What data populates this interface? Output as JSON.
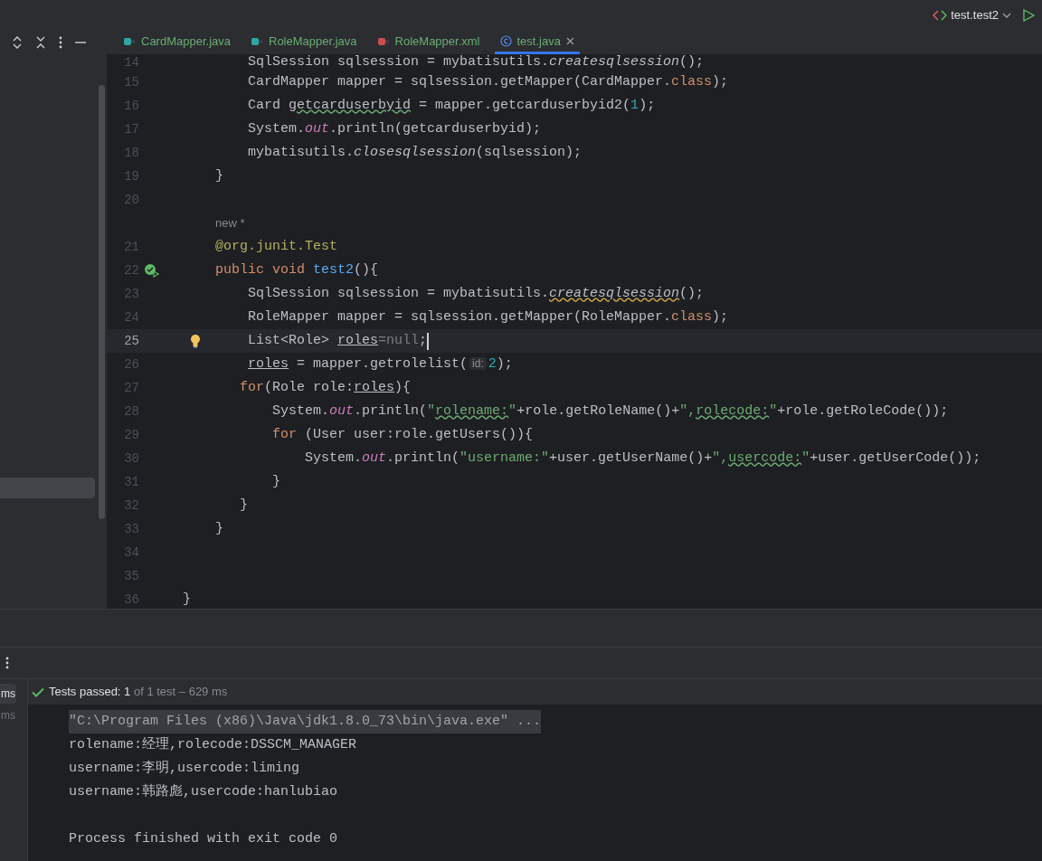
{
  "run_config": {
    "label": "test.test2"
  },
  "tabs": [
    {
      "label": "CardMapper.java",
      "kind": "interface",
      "selected": false
    },
    {
      "label": "RoleMapper.java",
      "kind": "interface",
      "selected": false
    },
    {
      "label": "RoleMapper.xml",
      "kind": "xml",
      "selected": false
    },
    {
      "label": "test.java",
      "kind": "class",
      "selected": true
    }
  ],
  "editor": {
    "lines": [
      {
        "kind": "code",
        "number": "14",
        "current": false,
        "tokens": [
          {
            "kind": "plain",
            "text": "        SqlSession sqlsession = mybatisutils."
          },
          {
            "kind": "static",
            "text": "createsqlsession"
          },
          {
            "kind": "plain",
            "text": "();"
          }
        ]
      },
      {
        "kind": "code",
        "number": "15",
        "current": false,
        "tokens": [
          {
            "kind": "plain",
            "text": "        CardMapper mapper = sqlsession.getMapper(CardMapper."
          },
          {
            "kind": "keyword",
            "text": "class"
          },
          {
            "kind": "plain",
            "text": ");"
          }
        ]
      },
      {
        "kind": "code",
        "number": "16",
        "current": false,
        "tokens": [
          {
            "kind": "plain",
            "text": "        Card "
          },
          {
            "kind": "typo",
            "text": "getcarduserbyid"
          },
          {
            "kind": "plain",
            "text": " = mapper.getcarduserbyid2("
          },
          {
            "kind": "number",
            "text": "1"
          },
          {
            "kind": "plain",
            "text": ");"
          }
        ]
      },
      {
        "kind": "code",
        "number": "17",
        "current": false,
        "tokens": [
          {
            "kind": "plain",
            "text": "        System."
          },
          {
            "kind": "field",
            "text": "out"
          },
          {
            "kind": "plain",
            "text": ".println(getcarduserbyid);"
          }
        ]
      },
      {
        "kind": "code",
        "number": "18",
        "current": false,
        "tokens": [
          {
            "kind": "plain",
            "text": "        mybatisutils."
          },
          {
            "kind": "static",
            "text": "closesqlsession"
          },
          {
            "kind": "plain",
            "text": "(sqlsession);"
          }
        ]
      },
      {
        "kind": "code",
        "number": "19",
        "current": false,
        "tokens": [
          {
            "kind": "plain",
            "text": "    }"
          }
        ]
      },
      {
        "kind": "code",
        "number": "20",
        "current": false
      },
      {
        "kind": "hint",
        "text": "new *"
      },
      {
        "kind": "code",
        "number": "21",
        "current": false,
        "tokens": [
          {
            "kind": "annotation",
            "text": "    @org.junit.Test"
          }
        ]
      },
      {
        "kind": "code",
        "number": "22",
        "current": false,
        "gutter_icon": {
          "kind": "test_passed"
        },
        "tokens": [
          {
            "kind": "keyword",
            "text": "    public void "
          },
          {
            "kind": "declaration",
            "text": "test2"
          },
          {
            "kind": "plain",
            "text": "(){"
          }
        ]
      },
      {
        "kind": "code",
        "number": "23",
        "current": false,
        "tokens": [
          {
            "kind": "plain",
            "text": "        SqlSession sqlsession = mybatisutils."
          },
          {
            "kind": "static_warning",
            "text": "createsqlsession"
          },
          {
            "kind": "plain",
            "text": "();"
          }
        ]
      },
      {
        "kind": "code",
        "number": "24",
        "current": false,
        "tokens": [
          {
            "kind": "plain",
            "text": "        RoleMapper mapper = sqlsession.getMapper(RoleMapper."
          },
          {
            "kind": "keyword",
            "text": "class"
          },
          {
            "kind": "plain",
            "text": ");"
          }
        ]
      },
      {
        "kind": "code",
        "number": "25",
        "current": true,
        "gutter_icon": {
          "kind": "intention_bulb"
        },
        "tokens": [
          {
            "kind": "plain",
            "text": "        List<Role> "
          },
          {
            "kind": "reassigned",
            "text": "roles"
          },
          {
            "kind": "dim",
            "text": "=null"
          },
          {
            "kind": "plain",
            "text": ";"
          }
        ]
      },
      {
        "kind": "code",
        "number": "26",
        "current": false,
        "tokens": [
          {
            "kind": "reassigned",
            "text": "        roles"
          },
          {
            "kind": "plain",
            "text": " = mapper.getrolelist("
          },
          {
            "kind": "inlay",
            "text": "id:"
          },
          {
            "kind": "number",
            "text": "2"
          },
          {
            "kind": "plain",
            "text": ");"
          }
        ]
      },
      {
        "kind": "code",
        "number": "27",
        "current": false,
        "tokens": [
          {
            "kind": "keyword",
            "text": "       for"
          },
          {
            "kind": "plain",
            "text": "(Role role:"
          },
          {
            "kind": "reassigned",
            "text": "roles"
          },
          {
            "kind": "plain",
            "text": "){"
          }
        ]
      },
      {
        "kind": "code",
        "number": "28",
        "current": false,
        "tokens": [
          {
            "kind": "plain",
            "text": "           System."
          },
          {
            "kind": "field",
            "text": "out"
          },
          {
            "kind": "plain",
            "text": ".println("
          },
          {
            "kind": "string",
            "text": "\""
          },
          {
            "kind": "string_typo",
            "text": "rolename:"
          },
          {
            "kind": "string",
            "text": "\""
          },
          {
            "kind": "plain",
            "text": "+role.getRoleName()+"
          },
          {
            "kind": "string",
            "text": "\","
          },
          {
            "kind": "string_typo",
            "text": "rolecode:"
          },
          {
            "kind": "string",
            "text": "\""
          },
          {
            "kind": "plain",
            "text": "+role.getRoleCode());"
          }
        ]
      },
      {
        "kind": "code",
        "number": "29",
        "current": false,
        "tokens": [
          {
            "kind": "keyword",
            "text": "           for"
          },
          {
            "kind": "plain",
            "text": " (User user:role.getUsers()){"
          }
        ]
      },
      {
        "kind": "code",
        "number": "30",
        "current": false,
        "tokens": [
          {
            "kind": "plain",
            "text": "               System."
          },
          {
            "kind": "field",
            "text": "out"
          },
          {
            "kind": "plain",
            "text": ".println("
          },
          {
            "kind": "string",
            "text": "\"username:\""
          },
          {
            "kind": "plain",
            "text": "+user.getUserName()+"
          },
          {
            "kind": "string",
            "text": "\","
          },
          {
            "kind": "string_typo",
            "text": "usercode:"
          },
          {
            "kind": "string",
            "text": "\""
          },
          {
            "kind": "plain",
            "text": "+user.getUserCode());"
          }
        ]
      },
      {
        "kind": "code",
        "number": "31",
        "current": false,
        "tokens": [
          {
            "kind": "plain",
            "text": "           }"
          }
        ]
      },
      {
        "kind": "code",
        "number": "32",
        "current": false,
        "tokens": [
          {
            "kind": "plain",
            "text": "       }"
          }
        ]
      },
      {
        "kind": "code",
        "number": "33",
        "current": false,
        "tokens": [
          {
            "kind": "plain",
            "text": "    }"
          }
        ]
      },
      {
        "kind": "code",
        "number": "34",
        "current": false
      },
      {
        "kind": "code",
        "number": "35",
        "current": false
      },
      {
        "kind": "code",
        "number": "36",
        "current": false,
        "tokens": [
          {
            "kind": "plain",
            "text": "}"
          }
        ]
      }
    ]
  },
  "run_panel": {
    "tests": [
      {
        "label": "ms",
        "selected": true
      },
      {
        "label": "ms",
        "selected": false
      }
    ],
    "status": {
      "label": "Tests passed:",
      "count": "1",
      "detail": "of 1 test – 629 ms"
    },
    "output": [
      {
        "kind": "command",
        "text": "\"C:\\Program Files (x86)\\Java\\jdk1.8.0_73\\bin\\java.exe\" ..."
      },
      {
        "kind": "plain",
        "text": "rolename:经理,rolecode:DSSCM_MANAGER"
      },
      {
        "kind": "plain",
        "text": "username:李明,usercode:liming"
      },
      {
        "kind": "plain",
        "text": "username:韩路彪,usercode:hanlubiao"
      },
      {
        "kind": "exit",
        "text": "Process finished with exit code 0"
      }
    ]
  }
}
